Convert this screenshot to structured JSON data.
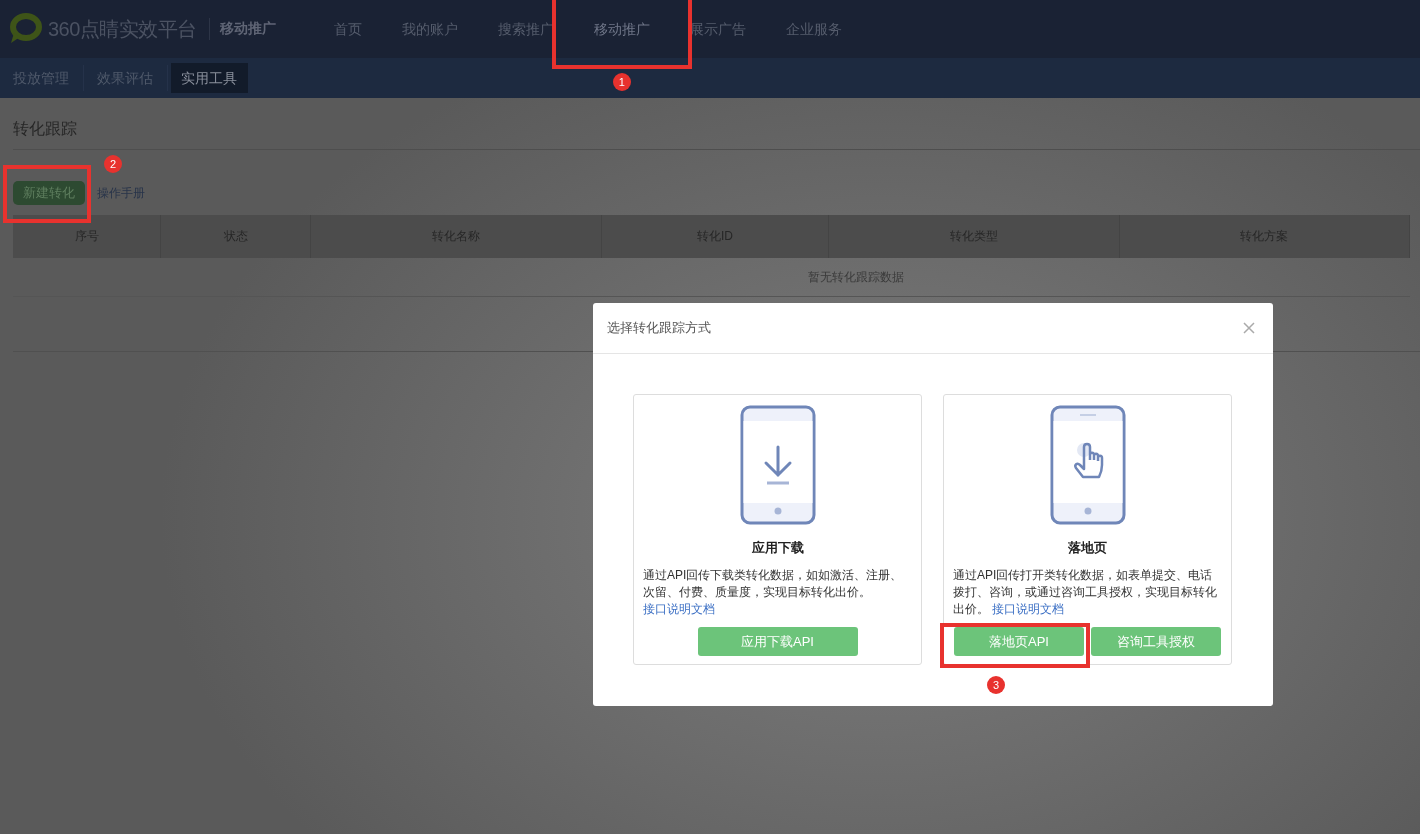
{
  "header": {
    "logo": "360点睛实效平台",
    "product": "移动推广",
    "nav": [
      {
        "label": "首页",
        "selected": false
      },
      {
        "label": "我的账户",
        "selected": false
      },
      {
        "label": "搜索推广",
        "selected": false
      },
      {
        "label": "移动推广",
        "selected": true,
        "annotation": "1"
      },
      {
        "label": "展示广告",
        "selected": false
      },
      {
        "label": "企业服务",
        "selected": false
      }
    ]
  },
  "subnav": [
    {
      "label": "投放管理",
      "selected": false
    },
    {
      "label": "效果评估",
      "selected": false
    },
    {
      "label": "实用工具",
      "selected": true
    }
  ],
  "page": {
    "title": "转化跟踪",
    "primary_button": {
      "label": "新建转化",
      "annotation": "2"
    },
    "manual_link": "操作手册"
  },
  "table": {
    "columns": [
      "序号",
      "状态",
      "转化名称",
      "转化ID",
      "转化类型",
      "转化方案"
    ],
    "empty_text": "暂无转化跟踪数据"
  },
  "modal": {
    "title": "选择转化跟踪方式",
    "options": [
      {
        "kind": "download",
        "title": "应用下载",
        "description": "通过API回传下载类转化数据，如如激活、注册、次留、付费、质量度，实现目标转化出价。",
        "link": "接口说明文档",
        "buttons": [
          {
            "label": "应用下载API"
          }
        ]
      },
      {
        "kind": "tap",
        "title": "落地页",
        "description": "通过API回传打开类转化数据，如表单提交、电话拨打、咨询，或通过咨询工具授权，实现目标转化出价。",
        "link": "接口说明文档",
        "buttons": [
          {
            "label": "落地页API",
            "annotation": "3"
          },
          {
            "label": "咨询工具授权"
          }
        ]
      }
    ]
  }
}
